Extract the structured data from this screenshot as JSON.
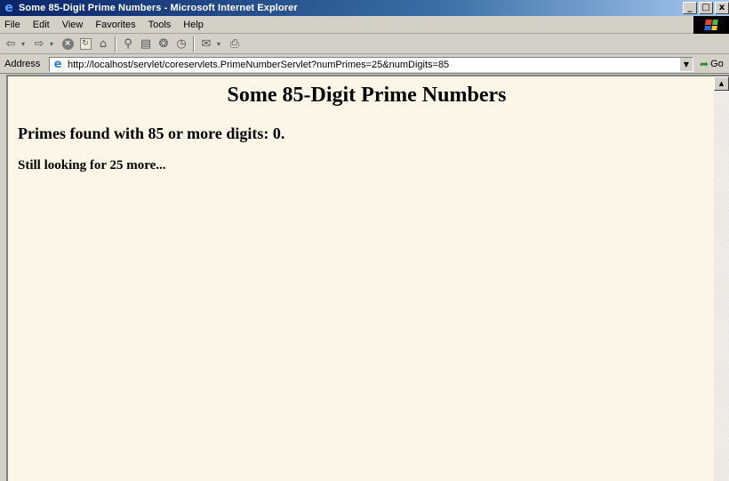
{
  "window": {
    "title": "Some 85-Digit Prime Numbers - Microsoft Internet Explorer",
    "minimize": "_",
    "maximize": "□",
    "close": "x"
  },
  "menu": {
    "items": [
      "File",
      "Edit",
      "View",
      "Favorites",
      "Tools",
      "Help"
    ]
  },
  "toolbar": {
    "icons": [
      "back-icon",
      "forward-icon",
      "stop-icon",
      "refresh-icon",
      "home-icon",
      "search-icon",
      "favorites-icon",
      "history-icon",
      "mail-icon",
      "print-icon"
    ]
  },
  "address": {
    "label": "Address",
    "url": "http://localhost/servlet/coreservlets.PrimeNumberServlet?numPrimes=25&numDigits=85",
    "go_label": "Go"
  },
  "page": {
    "heading": "Some 85-Digit Prime Numbers",
    "primes_found": "Primes found with 85 or more digits: 0.",
    "still_looking": "Still looking for 25 more..."
  },
  "colors": {
    "page_background": "#fdf5e6",
    "titlebar_start": "#0a246a",
    "titlebar_end": "#a6caf0",
    "chrome": "#d4d0c8"
  }
}
